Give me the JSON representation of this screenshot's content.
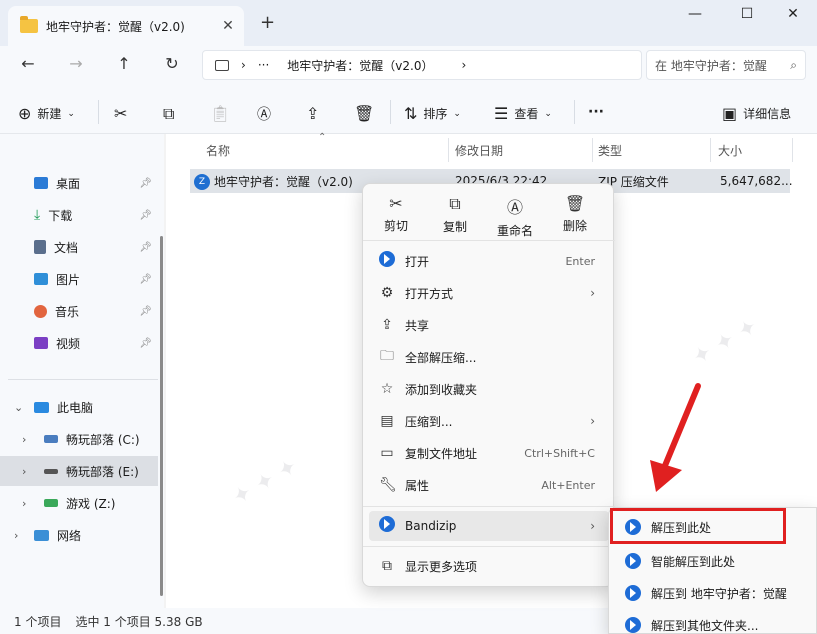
{
  "window": {
    "tab_title": "地牢守护者：觉醒（v2.0)",
    "tab_close": "✕",
    "new_tab": "+",
    "minimize": "—",
    "maximize": "☐",
    "close": "✕"
  },
  "nav": {
    "back": "←",
    "forward": "→",
    "up": "↑",
    "refresh": "↻",
    "more_path": "···",
    "path_folder": "地牢守护者：觉醒（v2.0）",
    "search_placeholder": "在 地牢守护者：觉醒"
  },
  "toolbar": {
    "new_label": "新建",
    "sort_label": "排序",
    "view_label": "查看",
    "more": "···",
    "details_label": "详细信息"
  },
  "sidebar": {
    "items": [
      {
        "label": "桌面",
        "color": "#2b7bd6"
      },
      {
        "label": "下载",
        "color": "#1d9a56"
      },
      {
        "label": "文档",
        "color": "#5a6e8c"
      },
      {
        "label": "图片",
        "color": "#2f8fd8"
      },
      {
        "label": "音乐",
        "color": "#e2653f"
      },
      {
        "label": "视频",
        "color": "#7b3fc4"
      }
    ],
    "this_pc": "此电脑",
    "drives": [
      {
        "label": "畅玩部落 (C:)"
      },
      {
        "label": "畅玩部落 (E:)"
      },
      {
        "label": "游戏 (Z:)"
      }
    ],
    "network": "网络"
  },
  "columns": {
    "name": "名称",
    "date": "修改日期",
    "type": "类型",
    "size": "大小"
  },
  "file": {
    "name": "地牢守护者：觉醒（v2.0)",
    "date": "2025/6/3 22:42",
    "type": "ZIP 压缩文件",
    "size": "5,647,682..."
  },
  "status": {
    "count": "1 个项目",
    "selected": "选中 1 个项目  5.38 GB"
  },
  "context_menu": {
    "quick": [
      {
        "label": "剪切"
      },
      {
        "label": "复制"
      },
      {
        "label": "重命名"
      },
      {
        "label": "删除"
      }
    ],
    "items": [
      {
        "label": "打开",
        "accel": "Enter"
      },
      {
        "label": "打开方式"
      },
      {
        "label": "共享"
      },
      {
        "label": "全部解压缩..."
      },
      {
        "label": "添加到收藏夹"
      },
      {
        "label": "压缩到..."
      },
      {
        "label": "复制文件地址",
        "accel": "Ctrl+Shift+C"
      },
      {
        "label": "属性",
        "accel": "Alt+Enter"
      }
    ],
    "bandizip": "Bandizip",
    "more_options": "显示更多选项"
  },
  "submenu": {
    "items": [
      {
        "label": "解压到此处"
      },
      {
        "label": "智能解压到此处"
      },
      {
        "label": "解压到 地牢守护者：觉醒"
      },
      {
        "label": "解压到其他文件夹..."
      }
    ]
  },
  "accent_red": "#e02020"
}
